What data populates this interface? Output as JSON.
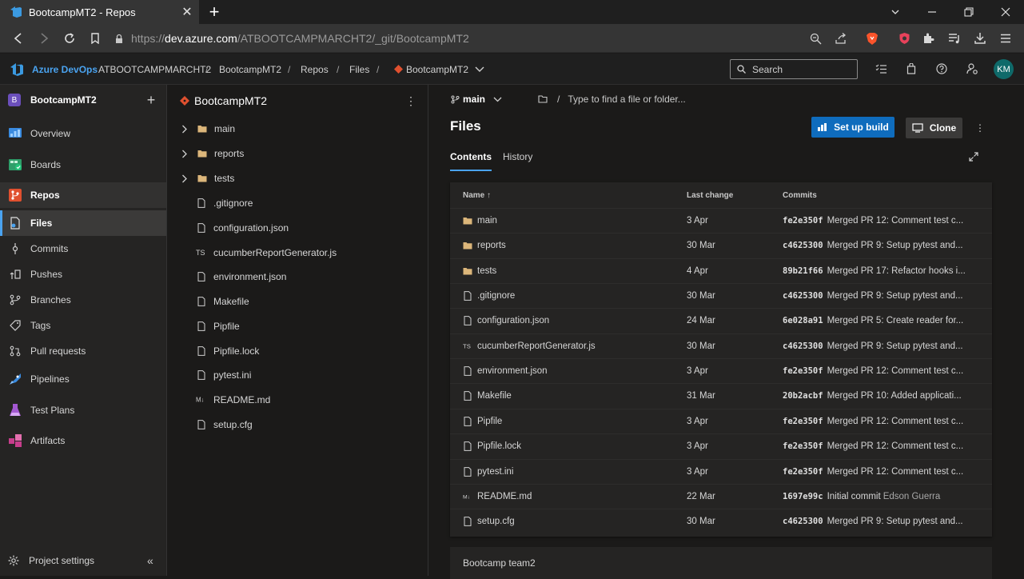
{
  "browser": {
    "tab_title": "BootcampMT2 - Repos",
    "url_prefix": "https://",
    "url_host": "dev.azure.com",
    "url_path": "/ATBOOTCAMPMARCHT2/_git/BootcampMT2"
  },
  "header": {
    "brand": "Azure DevOps",
    "org": "ATBOOTCAMPMARCHT2",
    "project": "BootcampMT2",
    "section": "Repos",
    "subsection": "Files",
    "repo": "BootcampMT2",
    "separator": "/",
    "search_placeholder": "Search",
    "avatar_initials": "KM"
  },
  "sidebar": {
    "project_initial": "B",
    "project_name": "BootcampMT2",
    "items": [
      {
        "label": "Overview"
      },
      {
        "label": "Boards"
      },
      {
        "label": "Repos"
      },
      {
        "label": "Files"
      },
      {
        "label": "Commits"
      },
      {
        "label": "Pushes"
      },
      {
        "label": "Branches"
      },
      {
        "label": "Tags"
      },
      {
        "label": "Pull requests"
      },
      {
        "label": "Pipelines"
      },
      {
        "label": "Test Plans"
      },
      {
        "label": "Artifacts"
      }
    ],
    "settings_label": "Project settings"
  },
  "tree": {
    "repo_name": "BootcampMT2",
    "items": [
      {
        "label": "main",
        "type": "folder"
      },
      {
        "label": "reports",
        "type": "folder"
      },
      {
        "label": "tests",
        "type": "folder"
      },
      {
        "label": ".gitignore",
        "type": "file"
      },
      {
        "label": "configuration.json",
        "type": "file"
      },
      {
        "label": "cucumberReportGenerator.js",
        "type": "ts"
      },
      {
        "label": "environment.json",
        "type": "file"
      },
      {
        "label": "Makefile",
        "type": "file"
      },
      {
        "label": "Pipfile",
        "type": "file"
      },
      {
        "label": "Pipfile.lock",
        "type": "file"
      },
      {
        "label": "pytest.ini",
        "type": "file"
      },
      {
        "label": "README.md",
        "type": "md"
      },
      {
        "label": "setup.cfg",
        "type": "file"
      }
    ]
  },
  "main": {
    "branch": "main",
    "path_placeholder": "Type to find a file or folder...",
    "title": "Files",
    "setup_build_label": "Set up build",
    "clone_label": "Clone",
    "tabs": [
      {
        "label": "Contents"
      },
      {
        "label": "History"
      }
    ],
    "columns": {
      "name": "Name",
      "last_change": "Last change",
      "commits": "Commits"
    },
    "rows": [
      {
        "name": "main",
        "type": "folder",
        "date": "3 Apr",
        "hash": "fe2e350f",
        "message": "Merged PR 12: Comment test c..."
      },
      {
        "name": "reports",
        "type": "folder",
        "date": "30 Mar",
        "hash": "c4625300",
        "message": "Merged PR 9: Setup pytest and..."
      },
      {
        "name": "tests",
        "type": "folder",
        "date": "4 Apr",
        "hash": "89b21f66",
        "message": "Merged PR 17: Refactor hooks i..."
      },
      {
        "name": ".gitignore",
        "type": "file",
        "date": "30 Mar",
        "hash": "c4625300",
        "message": "Merged PR 9: Setup pytest and..."
      },
      {
        "name": "configuration.json",
        "type": "file",
        "date": "24 Mar",
        "hash": "6e028a91",
        "message": "Merged PR 5: Create reader for..."
      },
      {
        "name": "cucumberReportGenerator.js",
        "type": "ts",
        "date": "30 Mar",
        "hash": "c4625300",
        "message": "Merged PR 9: Setup pytest and..."
      },
      {
        "name": "environment.json",
        "type": "file",
        "date": "3 Apr",
        "hash": "fe2e350f",
        "message": "Merged PR 12: Comment test c..."
      },
      {
        "name": "Makefile",
        "type": "file",
        "date": "31 Mar",
        "hash": "20b2acbf",
        "message": "Merged PR 10: Added applicati..."
      },
      {
        "name": "Pipfile",
        "type": "file",
        "date": "3 Apr",
        "hash": "fe2e350f",
        "message": "Merged PR 12: Comment test c..."
      },
      {
        "name": "Pipfile.lock",
        "type": "file",
        "date": "3 Apr",
        "hash": "fe2e350f",
        "message": "Merged PR 12: Comment test c..."
      },
      {
        "name": "pytest.ini",
        "type": "file",
        "date": "3 Apr",
        "hash": "fe2e350f",
        "message": "Merged PR 12: Comment test c..."
      },
      {
        "name": "README.md",
        "type": "md",
        "date": "22 Mar",
        "hash": "1697e99c",
        "message": "Initial commit",
        "author": "Edson Guerra"
      },
      {
        "name": "setup.cfg",
        "type": "file",
        "date": "30 Mar",
        "hash": "c4625300",
        "message": "Merged PR 9: Setup pytest and..."
      }
    ],
    "readme_title": "Bootcamp team2"
  },
  "colors": {
    "accent": "#0f6cbd",
    "brand": "#4aa3f0",
    "folder": "#dcb67a"
  }
}
